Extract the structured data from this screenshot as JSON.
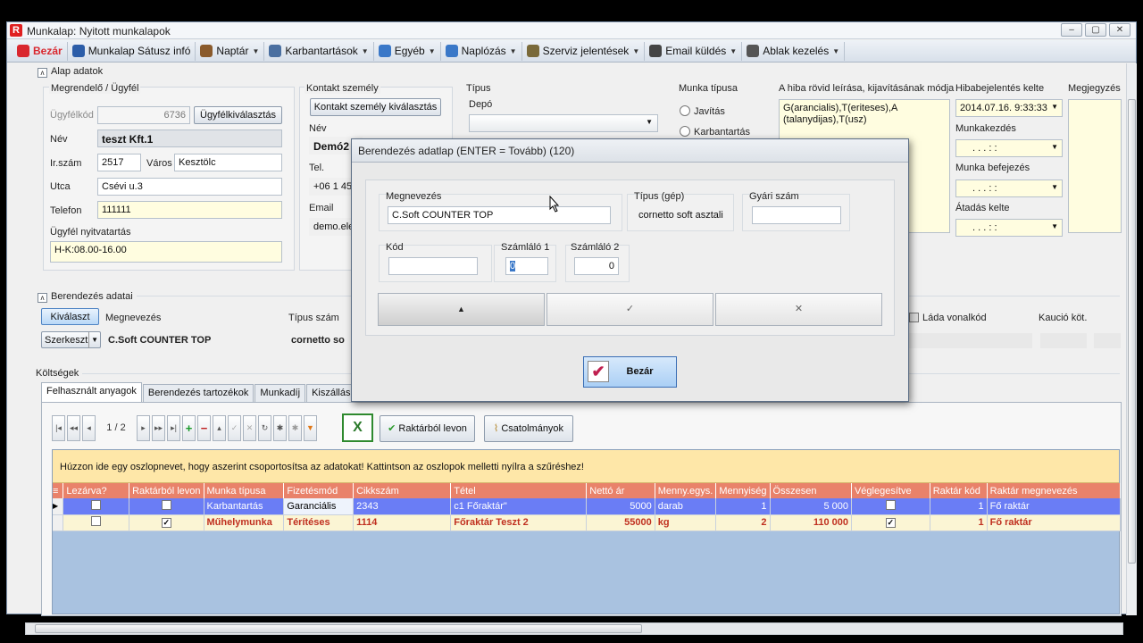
{
  "window": {
    "title": "Munkalap: Nyitott munkalapok",
    "app_letter": "R"
  },
  "menu": [
    {
      "label": "Bezár",
      "icon": "close-circle-icon",
      "color": "#d9272e",
      "dd": false,
      "bold": true,
      "text_color": "#d9272e"
    },
    {
      "label": "Munkalap Sátusz infó",
      "icon": "info-icon",
      "color": "#2c5da8",
      "dd": false
    },
    {
      "label": "Naptár",
      "icon": "calendar-icon",
      "color": "#8a5a2b",
      "dd": true
    },
    {
      "label": "Karbantartások",
      "icon": "tools-icon",
      "color": "#4a6fa0",
      "dd": true
    },
    {
      "label": "Egyéb",
      "icon": "globe-icon",
      "color": "#3a78c8",
      "dd": true
    },
    {
      "label": "Naplózás",
      "icon": "chart-icon",
      "color": "#3a78c8",
      "dd": true
    },
    {
      "label": "Szerviz jelentések",
      "icon": "wrench-icon",
      "color": "#7a6a3a",
      "dd": true
    },
    {
      "label": "Email küldés",
      "icon": "at-icon",
      "color": "#444",
      "dd": true
    },
    {
      "label": "Ablak kezelés",
      "icon": "window-icon",
      "color": "#555",
      "dd": true
    }
  ],
  "alap": {
    "section": "Alap adatok",
    "megrendelo": "Megrendelő / Ügyfél",
    "ugyfelkod_label": "Ügyfélkód",
    "ugyfelkod": "6736",
    "ugyfel_btn": "Ügyfélkiválasztás",
    "nev_label": "Név",
    "nev": "teszt Kft.1",
    "irszam_label": "Ir.szám",
    "irszam": "2517",
    "varos_label": "Város",
    "varos": "Kesztölc",
    "utca_label": "Utca",
    "utca": "Csévi u.3",
    "telefon_label": "Telefon",
    "telefon": "111111",
    "nyitva_label": "Ügyfél nyitvatartás",
    "nyitva": "H-K:08.00-16.00",
    "kontakt": "Kontakt személy",
    "kontakt_btn": "Kontakt személy kiválasztás",
    "k_nev_label": "Név",
    "k_nev": "Demó2",
    "k_tel_label": "Tel.",
    "k_tel": "+06 1 45",
    "k_email_label": "Email",
    "k_email": "demo.ele",
    "tipus": "Típus",
    "depo": "Depó",
    "munka_tipusa": "Munka típusa",
    "javitas": "Javítás",
    "karbantartas": "Karbantartás",
    "hiba_label": "A hiba rövid leírása, kijavításának módja",
    "hiba": "G(arancialis),T(eriteses),A (talanydijas),T(usz)",
    "hibabej_label": "Hibabejelentés kelte",
    "hibabej": "2014.07.16. 9:33:33",
    "munkakezdes": "Munkakezdés",
    "befejezes": "Munka befejezés",
    "atadas": "Átadás kelte",
    "empty_date": ". . . : :",
    "megjegyzes": "Megjegyzés"
  },
  "berendezes": {
    "section": "Berendezés adatai",
    "kivalaszt": "Kiválaszt",
    "szerkeszt": "Szerkeszt",
    "megnevezes_h": "Megnevezés",
    "tipus_h": "Típus szám",
    "megnevezes": "C.Soft COUNTER TOP",
    "tipus": "cornetto so",
    "lada": "Láda vonalkód",
    "kaucio": "Kaució köt."
  },
  "koltsegek": {
    "section": "Költségek",
    "tabs": [
      "Felhasznált anyagok",
      "Berendezés tartozékok",
      "Munkadíj",
      "Kiszállási kö"
    ],
    "page": "1 / 2",
    "raktar_btn": "Raktárból levon",
    "csatolmanyok": "Csatolmányok",
    "hint": "Húzzon ide egy oszlopnevet, hogy aszerint csoportosítsa az adatokat! Kattintson az oszlopok melletti nyílra a szűréshez!",
    "columns": [
      "Lezárva?",
      "Raktárból levon",
      "Munka típusa",
      "Fizetésmód",
      "Cikkszám",
      "Tétel",
      "Nettó ár",
      "Menny.egys.",
      "Mennyiség",
      "Összesen",
      "Véglegesítve",
      "Raktár kód",
      "Raktár megnevezés"
    ],
    "rows": [
      {
        "lezarva": false,
        "levon": false,
        "munka": "Karbantartás",
        "fizetes": "Garanciális",
        "cikk": "2343",
        "tetel": "c1 Főraktár\"",
        "netto": "5000",
        "egys": "darab",
        "menny": "1",
        "osszesen": "5 000",
        "vegleges": false,
        "rkod": "1",
        "rnev": "Fő raktár"
      },
      {
        "lezarva": false,
        "levon": true,
        "munka": "Műhelymunka",
        "fizetes": "Térítéses",
        "cikk": "1114",
        "tetel": "Főraktár Teszt 2",
        "netto": "55000",
        "egys": "kg",
        "menny": "2",
        "osszesen": "110 000",
        "vegleges": true,
        "rkod": "1",
        "rnev": "Fő raktár"
      }
    ]
  },
  "dialog": {
    "title": "Berendezés adatlap (ENTER = Tovább) (120)",
    "megnevezes_label": "Megnevezés",
    "megnevezes": "C.Soft COUNTER TOP",
    "tipus_label": "Típus (gép)",
    "tipus": "cornetto soft asztali",
    "gyari_label": "Gyári szám",
    "gyari": "",
    "kod_label": "Kód",
    "kod": "",
    "sz1_label": "Számláló 1",
    "sz1": "0",
    "sz2_label": "Számláló 2",
    "sz2": "0",
    "up": "▲",
    "ok": "✓",
    "cancel": "✕",
    "bezar": "Bezár"
  }
}
